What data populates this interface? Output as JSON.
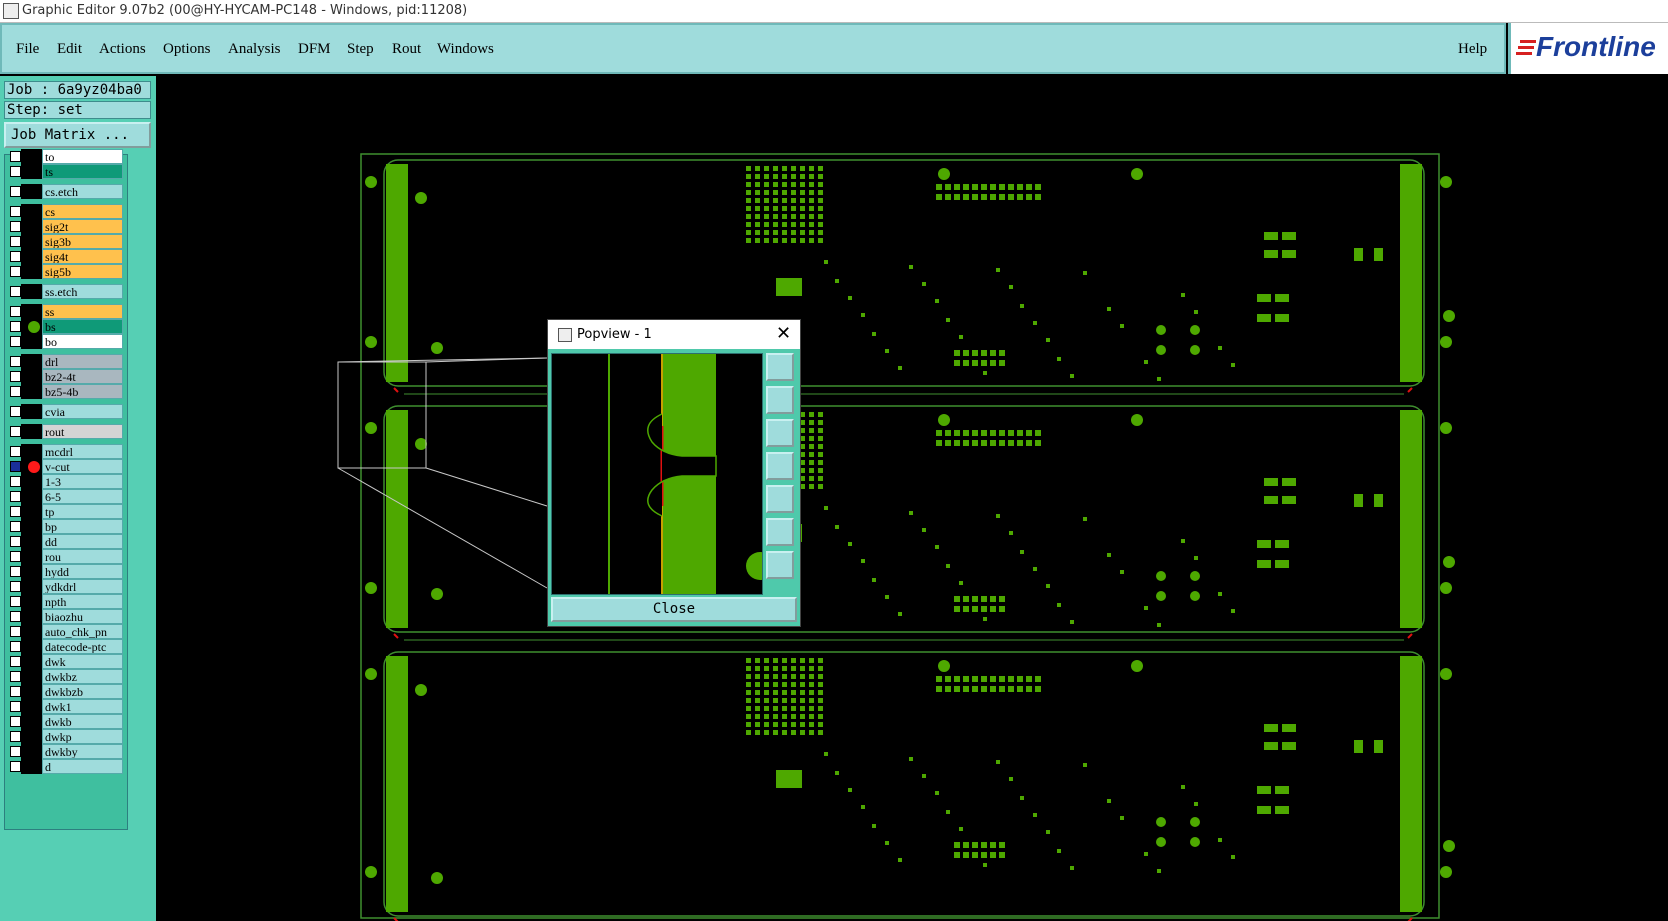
{
  "window": {
    "title": "Graphic Editor 9.07b2 (00@HY-HYCAM-PC148 - Windows, pid:11208)"
  },
  "menu": {
    "items": [
      "File",
      "Edit",
      "Actions",
      "Options",
      "Analysis",
      "DFM",
      "Step",
      "Rout",
      "Windows"
    ],
    "help": "Help"
  },
  "brand": {
    "name": "Frontline"
  },
  "job": {
    "job_label": "Job : 6a9yz04ba0",
    "step_label": "Step: set",
    "matrix_button": "Job Matrix ..."
  },
  "layers": [
    {
      "name": "to",
      "color": "#ffffff",
      "checked": false,
      "dot": ""
    },
    {
      "name": "ts",
      "color": "#0f9a78",
      "checked": false,
      "dot": ""
    },
    {
      "name": "cs.etch",
      "color": "#9fdcdc",
      "checked": false,
      "dot": ""
    },
    {
      "name": "cs",
      "color": "#ffc14d",
      "checked": false,
      "dot": ""
    },
    {
      "name": "sig2t",
      "color": "#ffc14d",
      "checked": false,
      "dot": ""
    },
    {
      "name": "sig3b",
      "color": "#ffc14d",
      "checked": false,
      "dot": ""
    },
    {
      "name": "sig4t",
      "color": "#ffc14d",
      "checked": false,
      "dot": ""
    },
    {
      "name": "sig5b",
      "color": "#ffc14d",
      "checked": false,
      "dot": ""
    },
    {
      "name": "ss.etch",
      "color": "#9fdcdc",
      "checked": false,
      "dot": ""
    },
    {
      "name": "ss",
      "color": "#ffc14d",
      "checked": false,
      "dot": ""
    },
    {
      "name": "bs",
      "color": "#0f9a78",
      "checked": false,
      "dot": "#4ea800"
    },
    {
      "name": "bo",
      "color": "#ffffff",
      "checked": false,
      "dot": ""
    },
    {
      "name": "drl",
      "color": "#a9b7bf",
      "checked": false,
      "dot": ""
    },
    {
      "name": "bz2-4t",
      "color": "#a9b7bf",
      "checked": false,
      "dot": ""
    },
    {
      "name": "bz5-4b",
      "color": "#a9b7bf",
      "checked": false,
      "dot": ""
    },
    {
      "name": "cvia",
      "color": "#9fdcdc",
      "checked": false,
      "dot": ""
    },
    {
      "name": "rout",
      "color": "#d4d4d4",
      "checked": false,
      "dot": ""
    },
    {
      "name": "mcdrl",
      "color": "#9fdcdc",
      "checked": false,
      "dot": ""
    },
    {
      "name": "v-cut",
      "color": "#9fdcdc",
      "checked": true,
      "dot": "#ff1a1a"
    },
    {
      "name": "1-3",
      "color": "#9fdcdc",
      "checked": false,
      "dot": ""
    },
    {
      "name": "6-5",
      "color": "#9fdcdc",
      "checked": false,
      "dot": ""
    },
    {
      "name": "tp",
      "color": "#9fdcdc",
      "checked": false,
      "dot": ""
    },
    {
      "name": "bp",
      "color": "#9fdcdc",
      "checked": false,
      "dot": ""
    },
    {
      "name": "dd",
      "color": "#9fdcdc",
      "checked": false,
      "dot": ""
    },
    {
      "name": "rou",
      "color": "#9fdcdc",
      "checked": false,
      "dot": ""
    },
    {
      "name": "hydd",
      "color": "#9fdcdc",
      "checked": false,
      "dot": ""
    },
    {
      "name": "ydkdrl",
      "color": "#9fdcdc",
      "checked": false,
      "dot": ""
    },
    {
      "name": "npth",
      "color": "#9fdcdc",
      "checked": false,
      "dot": ""
    },
    {
      "name": "biaozhu",
      "color": "#9fdcdc",
      "checked": false,
      "dot": ""
    },
    {
      "name": "auto_chk_pn",
      "color": "#9fdcdc",
      "checked": false,
      "dot": ""
    },
    {
      "name": "datecode-ptc",
      "color": "#9fdcdc",
      "checked": false,
      "dot": ""
    },
    {
      "name": "dwk",
      "color": "#9fdcdc",
      "checked": false,
      "dot": ""
    },
    {
      "name": "dwkbz",
      "color": "#9fdcdc",
      "checked": false,
      "dot": ""
    },
    {
      "name": "dwkbzb",
      "color": "#9fdcdc",
      "checked": false,
      "dot": ""
    },
    {
      "name": "dwk1",
      "color": "#9fdcdc",
      "checked": false,
      "dot": ""
    },
    {
      "name": "dwkb",
      "color": "#9fdcdc",
      "checked": false,
      "dot": ""
    },
    {
      "name": "dwkp",
      "color": "#9fdcdc",
      "checked": false,
      "dot": ""
    },
    {
      "name": "dwkby",
      "color": "#9fdcdc",
      "checked": false,
      "dot": ""
    },
    {
      "name": "d",
      "color": "#9fdcdc",
      "checked": false,
      "dot": ""
    }
  ],
  "popview": {
    "title": "Popview - 1",
    "close_label": "Close"
  },
  "colors": {
    "board_green": "#4ea800",
    "board_outline": "#3f8f2f",
    "vcut_red": "#e01010"
  }
}
